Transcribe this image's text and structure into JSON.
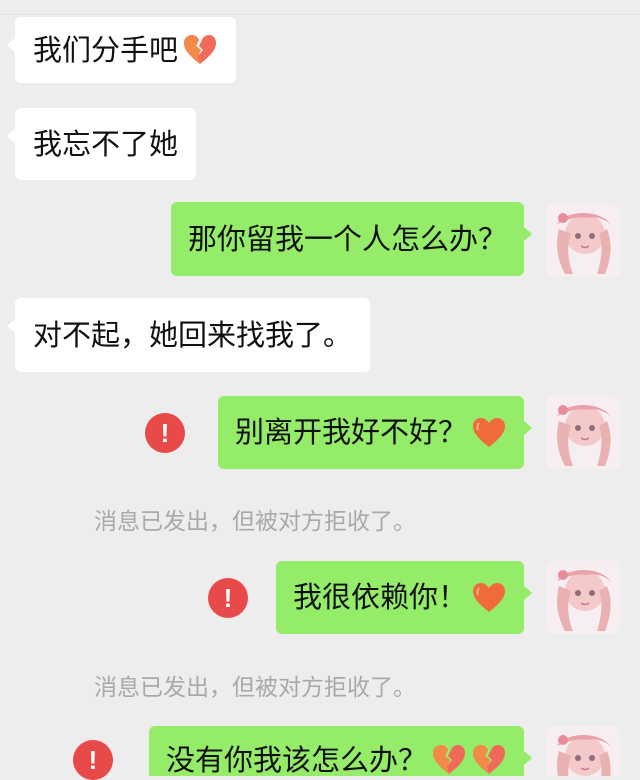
{
  "chat": {
    "messages": [
      {
        "side": "left",
        "text": "我们分手吧",
        "emoji": "broken-heart-icon"
      },
      {
        "side": "left",
        "text": "我忘不了她"
      },
      {
        "side": "right",
        "text": "那你留我一个人怎么办？"
      },
      {
        "side": "left",
        "text": "对不起，她回来找我了。"
      },
      {
        "side": "right",
        "text": "别离开我好不好？",
        "emoji": "red-heart-icon",
        "failed": true
      },
      {
        "side": "right",
        "text": "我很依赖你！",
        "emoji": "red-heart-icon",
        "failed": true
      },
      {
        "side": "right",
        "text": "没有你我该怎么办？",
        "emoji": "broken-heart-icon",
        "emoji_count": 2,
        "failed": true
      }
    ],
    "system_notes": [
      "消息已发出，但被对方拒收了。",
      "消息已发出，但被对方拒收了。"
    ],
    "alert_symbol": "!"
  },
  "colors": {
    "background": "#ededed",
    "incoming_bubble": "#ffffff",
    "outgoing_bubble": "#95ec69",
    "alert_red": "#e84a4a",
    "note_gray": "#a9a9a9"
  }
}
